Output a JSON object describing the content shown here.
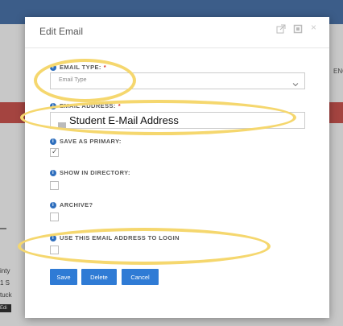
{
  "background": {
    "right_fragment": "ENC",
    "left_fragments": [
      "inty",
      "1 S",
      "tuck"
    ],
    "badge": "Edi"
  },
  "modal": {
    "title": "Edit Email",
    "header_icons": [
      "external-link-icon",
      "maximize-icon",
      "close-icon"
    ],
    "close_glyph": "×"
  },
  "fields": {
    "email_type": {
      "label": "EMAIL TYPE:",
      "required": "*",
      "placeholder": "Email Type"
    },
    "email_address": {
      "label": "EMAIL ADDRESS:",
      "required": "*",
      "value": "Student E-Mail Address"
    },
    "save_as_primary": {
      "label": "SAVE AS PRIMARY:",
      "checked": true
    },
    "show_in_directory": {
      "label": "SHOW IN DIRECTORY:",
      "checked": false
    },
    "archive": {
      "label": "ARCHIVE?",
      "checked": false
    },
    "use_to_login": {
      "label": "USE THIS EMAIL ADDRESS TO LOGIN",
      "checked": false
    }
  },
  "buttons": {
    "save": "Save",
    "delete": "Delete",
    "cancel": "Cancel"
  },
  "colors": {
    "button": "#2f7bd5",
    "highlight": "#f5d76e",
    "required": "#d9342b",
    "info": "#2e6ebd"
  }
}
